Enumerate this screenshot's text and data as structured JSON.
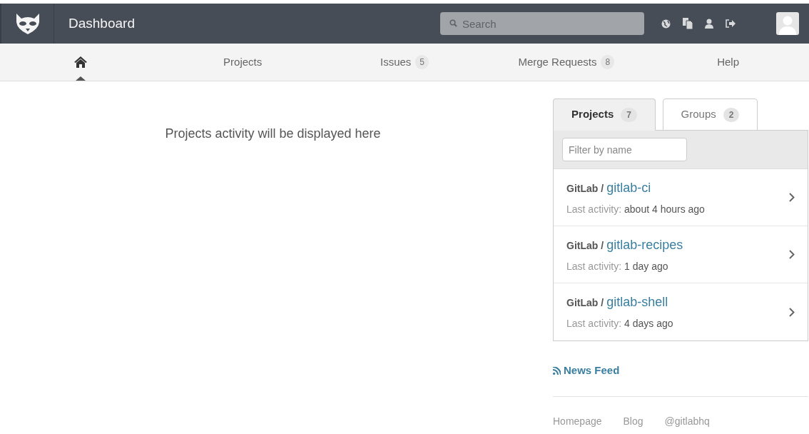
{
  "header": {
    "title": "Dashboard",
    "search": {
      "placeholder": "Search"
    }
  },
  "nav": [
    {
      "kind": "home",
      "selected": true
    },
    {
      "kind": "link",
      "label": "Projects",
      "selected": false
    },
    {
      "kind": "link",
      "label": "Issues",
      "count": "5",
      "selected": false
    },
    {
      "kind": "link",
      "label": "Merge Requests",
      "count": "8",
      "selected": false
    },
    {
      "kind": "link",
      "label": "Help",
      "selected": false
    }
  ],
  "activity": {
    "message": "Projects activity will be displayed here"
  },
  "panel": {
    "tabs": [
      {
        "label": "Projects",
        "count": "7",
        "selected": true
      },
      {
        "label": "Groups",
        "count": "2",
        "selected": false
      }
    ],
    "filter": {
      "placeholder": "Filter by name"
    },
    "projects": [
      {
        "namespace": "GitLab /",
        "name": "gitlab-ci",
        "activity_label": "Last activity:",
        "activity": "about 4 hours ago"
      },
      {
        "namespace": "GitLab /",
        "name": "gitlab-recipes",
        "activity_label": "Last activity:",
        "activity": "1 day ago"
      },
      {
        "namespace": "GitLab /",
        "name": "gitlab-shell",
        "activity_label": "Last activity:",
        "activity": "4 days ago"
      }
    ]
  },
  "news_feed": "News Feed",
  "footer_links": [
    "Homepage",
    "Blog",
    "@gitlabhq"
  ]
}
